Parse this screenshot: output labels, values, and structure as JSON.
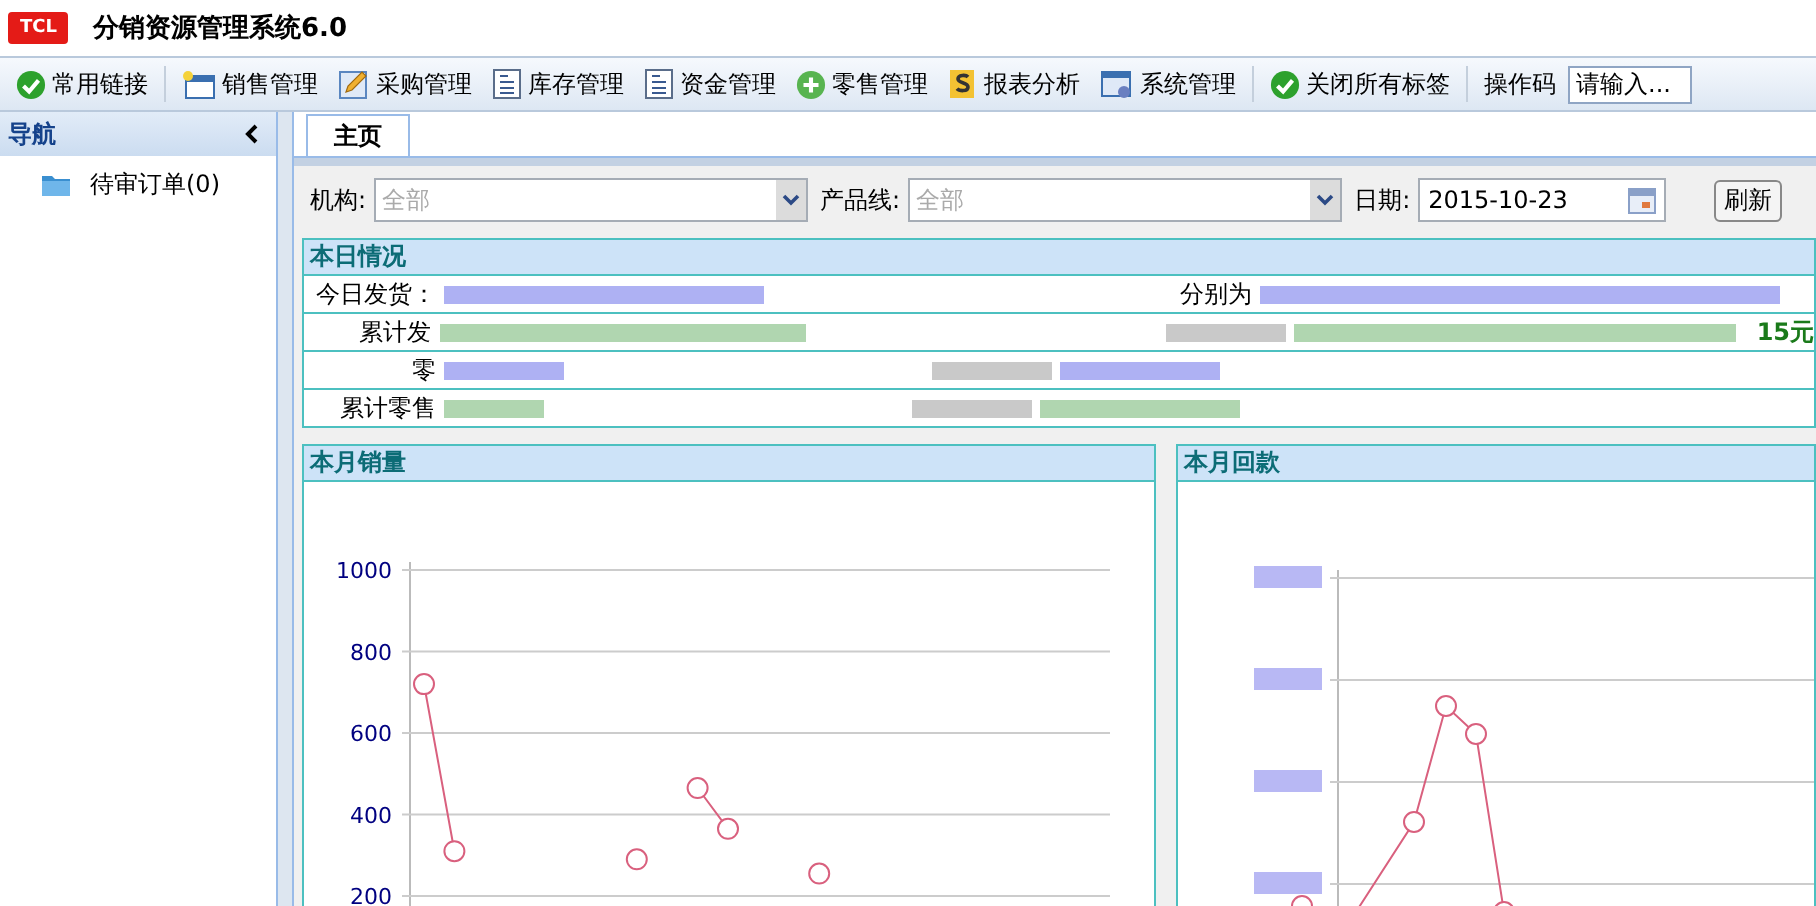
{
  "app": {
    "logo": "TCL",
    "title": "分销资源管理系统6.0"
  },
  "toolbar": {
    "items": [
      {
        "label": "常用链接",
        "kind": "check"
      },
      {
        "label": "销售管理",
        "kind": "window"
      },
      {
        "label": "采购管理",
        "kind": "edit"
      },
      {
        "label": "库存管理",
        "kind": "doc"
      },
      {
        "label": "资金管理",
        "kind": "doc"
      },
      {
        "label": "零售管理",
        "kind": "plus"
      },
      {
        "label": "报表分析",
        "kind": "report"
      },
      {
        "label": "系统管理",
        "kind": "system"
      },
      {
        "label": "关闭所有标签",
        "kind": "check"
      }
    ],
    "code_label": "操作码",
    "code_field": {
      "placeholder": "请输入..."
    }
  },
  "nav": {
    "title": "导航",
    "items": [
      {
        "label": "待审订单(0)"
      }
    ]
  },
  "tabs": [
    {
      "label": "主页",
      "selected": true
    }
  ],
  "filters": {
    "org": {
      "label": "机构:",
      "value": "全部"
    },
    "product_line": {
      "label": "产品线:",
      "value": "全部"
    },
    "date": {
      "label": "日期:",
      "value": "2015-10-23"
    },
    "refresh": "刷新"
  },
  "today_panel": {
    "title": "本日情况",
    "rows": [
      {
        "label": "今日发货：",
        "label_2": "分别为"
      },
      {
        "label": "累计发",
        "suffix": "15元"
      },
      {
        "label": "零"
      },
      {
        "label": "累计零售"
      }
    ]
  },
  "sales_panel": {
    "title": "本月销量",
    "chart_data": {
      "type": "line",
      "ylim": [
        200,
        1000
      ],
      "yticks": [
        200,
        400,
        600,
        800,
        1000
      ],
      "grid": true,
      "series": [
        {
          "color": "#d9607e",
          "marker": "circle",
          "values": [
            720,
            310,
            null,
            null,
            null,
            null,
            null,
            290,
            null,
            465,
            365,
            null,
            null,
            255,
            null,
            null,
            null,
            null,
            null,
            null,
            null,
            null,
            null
          ]
        }
      ]
    }
  },
  "payment_panel": {
    "title": "本月回款"
  }
}
